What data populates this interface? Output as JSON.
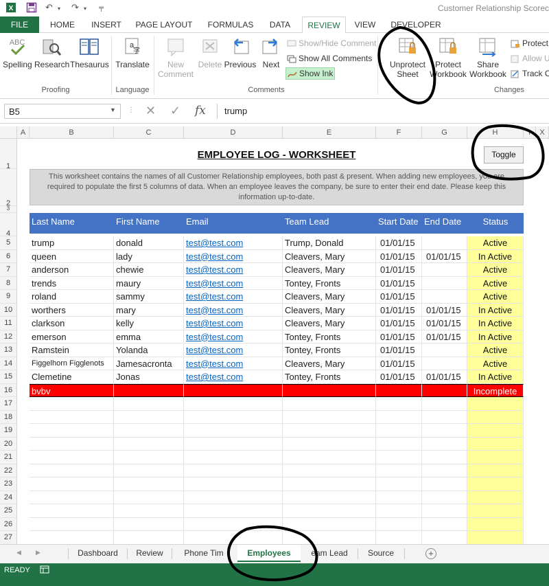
{
  "window": {
    "doc_title": "Customer Relationship Scorec"
  },
  "ribbon_tabs": [
    "FILE",
    "HOME",
    "INSERT",
    "PAGE LAYOUT",
    "FORMULAS",
    "DATA",
    "REVIEW",
    "VIEW",
    "DEVELOPER"
  ],
  "ribbon": {
    "proofing": {
      "spelling": "Spelling",
      "research": "Research",
      "thesaurus": "Thesaurus",
      "group": "Proofing"
    },
    "language": {
      "translate": "Translate",
      "group": "Language"
    },
    "comments": {
      "new_comment": "New Comment",
      "new_line1": "New",
      "new_line2": "Comment",
      "delete": "Delete",
      "previous": "Previous",
      "next": "Next",
      "show_hide": "Show/Hide Comment",
      "show_all": "Show All Comments",
      "show_ink": "Show Ink",
      "group": "Comments"
    },
    "changes": {
      "unprotect_l1": "Unprotect",
      "unprotect_l2": "Sheet",
      "protect_l1": "Protect",
      "protect_l2": "Workbook",
      "share_l1": "Share",
      "share_l2": "Workbook",
      "protect_share": "Protect",
      "allow_users": "Allow U",
      "track_changes": "Track C",
      "group": "Changes"
    }
  },
  "formula_bar": {
    "name_box": "B5",
    "fx": "fx",
    "value": "trump"
  },
  "columns": [
    "A",
    "B",
    "C",
    "D",
    "E",
    "F",
    "G",
    "H",
    "I",
    "X"
  ],
  "sheet": {
    "title": "EMPLOYEE LOG - WORKSHEET",
    "description": "This worksheet contains the names of all Customer Relationship employees, both past & present. When adding new employees, you are required to populate the first 5 columns of data. When an employee leaves the company, be sure to enter their end date. Please keep this information up-to-date.",
    "toggle": "Toggle",
    "headers": [
      "Last Name",
      "First Name",
      "Email",
      "Team Lead",
      "Start Date",
      "End Date",
      "Status"
    ],
    "rows": [
      [
        "trump",
        "donald",
        "test@test.com",
        "Trump, Donald",
        "01/01/15",
        "",
        "Active"
      ],
      [
        "queen",
        "lady",
        "test@test.com",
        "Cleavers, Mary",
        "01/01/15",
        "01/01/15",
        "In Active"
      ],
      [
        "anderson",
        "chewie",
        "test@test.com",
        "Cleavers, Mary",
        "01/01/15",
        "",
        "Active"
      ],
      [
        "trends",
        "maury",
        "test@test.com",
        "Tontey, Fronts",
        "01/01/15",
        "",
        "Active"
      ],
      [
        "roland",
        "sammy",
        "test@test.com",
        "Cleavers, Mary",
        "01/01/15",
        "",
        "Active"
      ],
      [
        "worthers",
        "mary",
        "test@test.com",
        "Cleavers, Mary",
        "01/01/15",
        "01/01/15",
        "In Active"
      ],
      [
        "clarkson",
        "kelly",
        "test@test.com",
        "Cleavers, Mary",
        "01/01/15",
        "01/01/15",
        "In Active"
      ],
      [
        "emerson",
        "emma",
        "test@test.com",
        "Tontey, Fronts",
        "01/01/15",
        "01/01/15",
        "In Active"
      ],
      [
        "Ramstein",
        "Yolanda",
        "test@test.com",
        "Tontey, Fronts",
        "01/01/15",
        "",
        "Active"
      ],
      [
        "Figgelhorn Figglenots",
        "Jamesacronta",
        "test@test.com",
        "Cleavers, Mary",
        "01/01/15",
        "",
        "Active"
      ],
      [
        "Clemetine",
        "Jonas",
        "test@test.com",
        "Tontey, Fronts",
        "01/01/15",
        "01/01/15",
        "In Active"
      ],
      [
        "bvbv",
        "",
        "",
        "",
        "",
        "",
        "Incomplete"
      ]
    ],
    "row_numbers": [
      "1",
      "2",
      "3",
      "4",
      "5",
      "6",
      "7",
      "8",
      "9",
      "10",
      "11",
      "12",
      "13",
      "14",
      "15",
      "16",
      "17",
      "18",
      "19",
      "20",
      "21",
      "22",
      "23",
      "24",
      "25",
      "26",
      "27"
    ]
  },
  "sheet_tabs": [
    "Dashboard",
    "Review",
    "Phone Tim",
    "Employees",
    "eam Lead",
    "Source"
  ],
  "active_sheet": "Employees",
  "status": {
    "ready": "READY"
  },
  "colors": {
    "excel_green": "#217346",
    "header_blue": "#4472c4",
    "status_yellow": "#ffff99",
    "incomplete_red": "#ff0000",
    "link_blue": "#0563c1"
  }
}
